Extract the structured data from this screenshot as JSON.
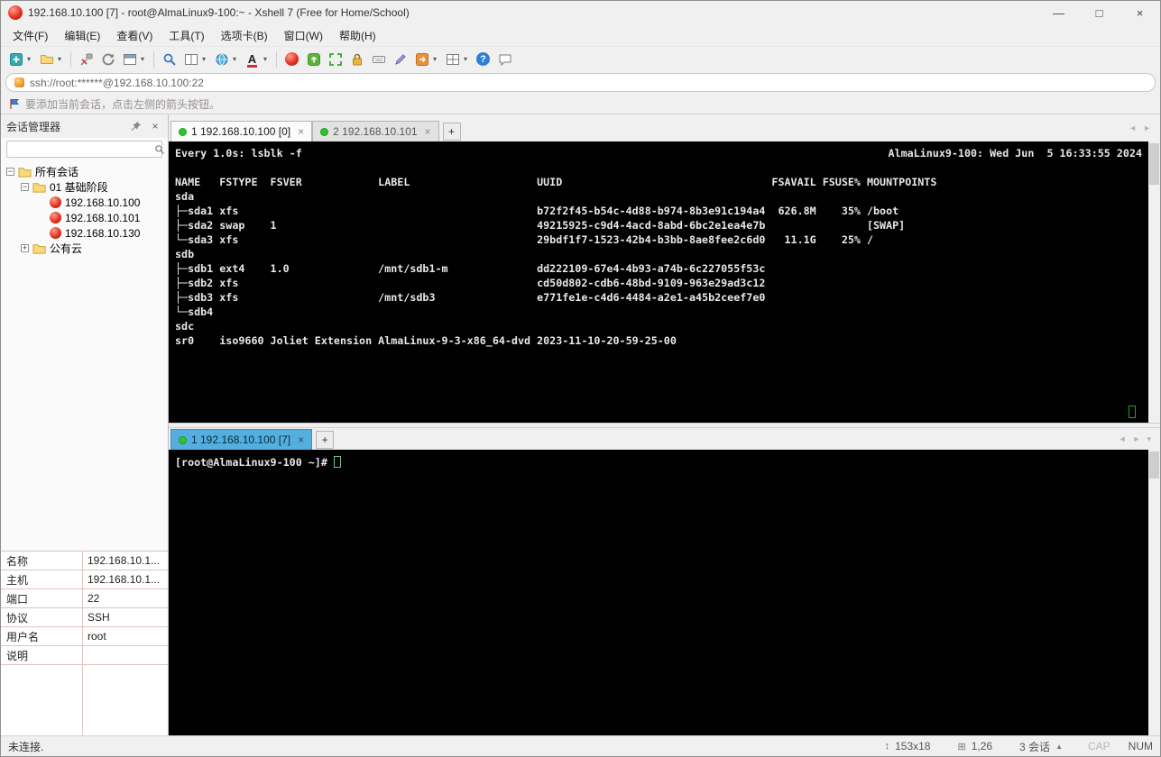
{
  "window": {
    "title": "192.168.10.100 [7] - root@AlmaLinux9-100:~ - Xshell 7 (Free for Home/School)"
  },
  "glyphs": {
    "minimize": "—",
    "maximize": "□",
    "close": "×",
    "dropdown": "▾",
    "tab_add": "+",
    "tab_close": "×",
    "nav_left": "◄",
    "nav_right": "►",
    "minus": "−",
    "plus": "+",
    "question": "?",
    "font_a": "A",
    "up_triangle": "▲",
    "size_icon": "↕",
    "pos_icon": "⊞"
  },
  "menu": {
    "items": [
      "文件(F)",
      "编辑(E)",
      "查看(V)",
      "工具(T)",
      "选项卡(B)",
      "窗口(W)",
      "帮助(H)"
    ]
  },
  "address": {
    "value": "ssh://root:******@192.168.10.100:22"
  },
  "notice": {
    "text": "要添加当前会话，点击左侧的箭头按钮。"
  },
  "session_manager": {
    "title": "会话管理器",
    "tree": {
      "all_sessions": "所有会话",
      "group": "01 基础阶段",
      "sessions": [
        "192.168.10.100",
        "192.168.10.101",
        "192.168.10.130"
      ],
      "cloud_group": "公有云"
    },
    "properties": {
      "rows": [
        {
          "label": "名称",
          "value": "192.168.10.1..."
        },
        {
          "label": "主机",
          "value": "192.168.10.1..."
        },
        {
          "label": "端口",
          "value": "22"
        },
        {
          "label": "协议",
          "value": "SSH"
        },
        {
          "label": "用户名",
          "value": "root"
        },
        {
          "label": "说明",
          "value": ""
        }
      ]
    }
  },
  "top_pane": {
    "tabs": [
      {
        "label": "1 192.168.10.100 [0]"
      },
      {
        "label": "2 192.168.10.101"
      }
    ],
    "watch_left": "Every 1.0s: lsblk -f",
    "watch_right": "AlmaLinux9-100: Wed Jun  5 16:33:55 2024",
    "table_rows": [
      [],
      [
        [
          0,
          "NAME"
        ],
        [
          7,
          "FSTYPE"
        ],
        [
          15,
          "FSVER"
        ],
        [
          32,
          "LABEL"
        ],
        [
          57,
          "UUID"
        ],
        [
          94,
          "FSAVAIL"
        ],
        [
          102,
          "FSUSE%"
        ],
        [
          109,
          "MOUNTPOINTS"
        ]
      ],
      [
        [
          0,
          "sda"
        ]
      ],
      [
        [
          0,
          "├─sda1"
        ],
        [
          7,
          "xfs"
        ],
        [
          57,
          "b72f2f45-b54c-4d88-b974-8b3e91c194a4"
        ],
        [
          95,
          "626.8M"
        ],
        [
          105,
          "35%"
        ],
        [
          109,
          "/boot"
        ]
      ],
      [
        [
          0,
          "├─sda2"
        ],
        [
          7,
          "swap"
        ],
        [
          15,
          "1"
        ],
        [
          57,
          "49215925-c9d4-4acd-8abd-6bc2e1ea4e7b"
        ],
        [
          109,
          "[SWAP]"
        ]
      ],
      [
        [
          0,
          "└─sda3"
        ],
        [
          7,
          "xfs"
        ],
        [
          57,
          "29bdf1f7-1523-42b4-b3bb-8ae8fee2c6d0"
        ],
        [
          96,
          "11.1G"
        ],
        [
          105,
          "25%"
        ],
        [
          109,
          "/"
        ]
      ],
      [
        [
          0,
          "sdb"
        ]
      ],
      [
        [
          0,
          "├─sdb1"
        ],
        [
          7,
          "ext4"
        ],
        [
          15,
          "1.0"
        ],
        [
          32,
          "/mnt/sdb1-m"
        ],
        [
          57,
          "dd222109-67e4-4b93-a74b-6c227055f53c"
        ]
      ],
      [
        [
          0,
          "├─sdb2"
        ],
        [
          7,
          "xfs"
        ],
        [
          57,
          "cd50d802-cdb6-48bd-9109-963e29ad3c12"
        ]
      ],
      [
        [
          0,
          "├─sdb3"
        ],
        [
          7,
          "xfs"
        ],
        [
          32,
          "/mnt/sdb3"
        ],
        [
          57,
          "e771fe1e-c4d6-4484-a2e1-a45b2ceef7e0"
        ]
      ],
      [
        [
          0,
          "└─sdb4"
        ]
      ],
      [
        [
          0,
          "sdc"
        ]
      ],
      [
        [
          0,
          "sr0"
        ],
        [
          7,
          "iso9660"
        ],
        [
          15,
          "Joliet Extension"
        ],
        [
          32,
          "AlmaLinux-9-3-x86_64-dvd"
        ],
        [
          57,
          "2023-11-10-20-59-25-00"
        ]
      ]
    ]
  },
  "bottom_pane": {
    "tabs": [
      {
        "label": "1 192.168.10.100 [7]"
      }
    ],
    "prompt": "[root@AlmaLinux9-100 ~]# "
  },
  "statusbar": {
    "left": "未连接.",
    "size": "153x18",
    "cursor": "1,26",
    "sessions": "3 会话",
    "cap": "CAP",
    "num": "NUM"
  }
}
